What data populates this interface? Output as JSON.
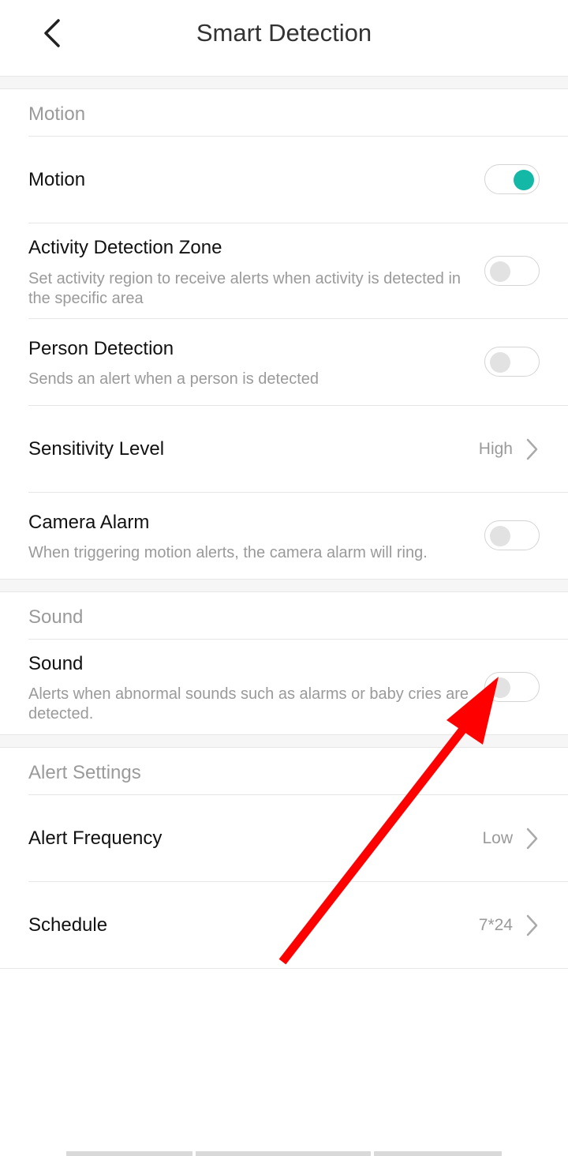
{
  "header": {
    "title": "Smart Detection",
    "back_icon": "chevron-left-icon"
  },
  "sections": {
    "motion": {
      "label": "Motion",
      "motion": {
        "title": "Motion",
        "enabled": true
      },
      "activity_zone": {
        "title": "Activity Detection Zone",
        "desc": "Set activity region to receive alerts when activity is detected in the specific area",
        "enabled": false
      },
      "person": {
        "title": "Person Detection",
        "desc": "Sends an alert when a person is detected",
        "enabled": false
      },
      "sensitivity": {
        "title": "Sensitivity Level",
        "value": "High"
      },
      "camera_alarm": {
        "title": "Camera Alarm",
        "desc": "When triggering motion alerts, the camera alarm will ring.",
        "enabled": false
      }
    },
    "sound": {
      "label": "Sound",
      "sound": {
        "title": "Sound",
        "desc": "Alerts when abnormal sounds such as alarms or baby cries are detected.",
        "enabled": false
      }
    },
    "alerts": {
      "label": "Alert Settings",
      "frequency": {
        "title": "Alert Frequency",
        "value": "Low"
      },
      "schedule": {
        "title": "Schedule",
        "value": "7*24"
      }
    }
  },
  "colors": {
    "accent": "#14b8a6",
    "annotation_arrow": "#ff0000"
  }
}
